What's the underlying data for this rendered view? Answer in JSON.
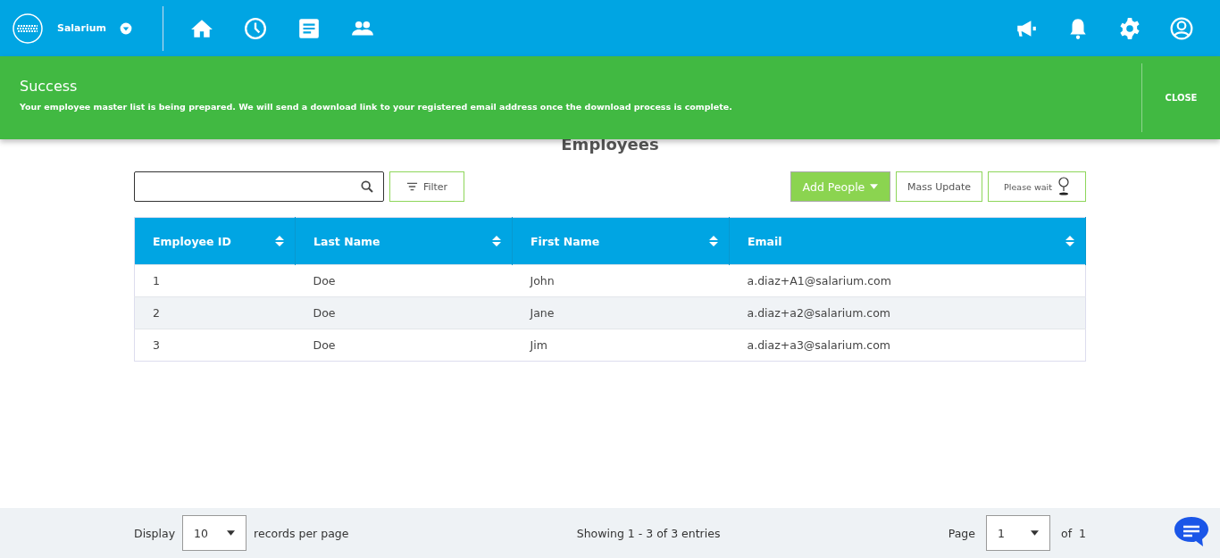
{
  "header": {
    "company": "Salarium"
  },
  "alert": {
    "title": "Success",
    "message": "Your employee master list is being prepared. We will send a download link to your registered email address once the download process is complete.",
    "close": "CLOSE"
  },
  "page_title": "Employees",
  "toolbar": {
    "filter": "Filter",
    "add_people": "Add People",
    "mass_update": "Mass Update",
    "please_wait": "Please wait"
  },
  "table": {
    "columns": [
      "Employee ID",
      "Last Name",
      "First Name",
      "Email"
    ],
    "rows": [
      [
        "1",
        "Doe",
        "John",
        "a.diaz+A1@salarium.com"
      ],
      [
        "2",
        "Doe",
        "Jane",
        "a.diaz+a2@salarium.com"
      ],
      [
        "3",
        "Doe",
        "Jim",
        "a.diaz+a3@salarium.com"
      ]
    ]
  },
  "footer": {
    "display": "Display",
    "page_size": "10",
    "records_per_page": "records per page",
    "showing": "Showing 1 - 3 of 3 entries",
    "page_label": "Page",
    "page": "1",
    "of": "of",
    "total_pages": "1"
  }
}
